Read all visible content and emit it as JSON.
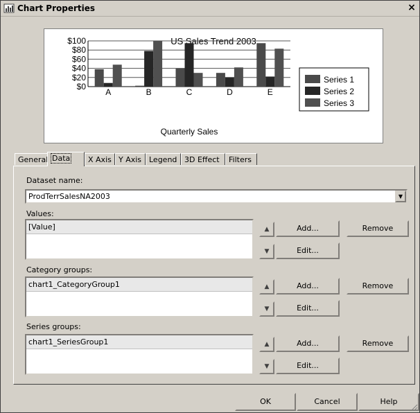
{
  "window": {
    "title": "Chart Properties",
    "close_glyph": "×",
    "app_icon": "chart-icon"
  },
  "chart_data": {
    "type": "bar",
    "title": "US Sales Trend 2003",
    "xlabel": "Quarterly Sales",
    "ylabel": "",
    "categories": [
      "A",
      "B",
      "C",
      "D",
      "E"
    ],
    "y_tick_labels": [
      "$100",
      "$80",
      "$60",
      "$40",
      "$20",
      "$0"
    ],
    "ylim": [
      0,
      100
    ],
    "grid": true,
    "legend_position": "right",
    "series": [
      {
        "name": "Series 1",
        "values": [
          38,
          2,
          40,
          30,
          95
        ],
        "color": "#4a4a4a"
      },
      {
        "name": "Series 2",
        "values": [
          8,
          78,
          95,
          20,
          22
        ],
        "color": "#262626"
      },
      {
        "name": "Series 3",
        "values": [
          48,
          100,
          30,
          42,
          83
        ],
        "color": "#505050"
      }
    ]
  },
  "tabs": [
    "General",
    "Data",
    "X Axis",
    "Y Axis",
    "Legend",
    "3D Effect",
    "Filters"
  ],
  "active_tab": "Data",
  "dataset": {
    "label": "Dataset name:",
    "value": "ProdTerrSalesNA2003"
  },
  "values_section": {
    "label": "Values:",
    "item": "[Value]"
  },
  "category_section": {
    "label": "Category groups:",
    "item": "chart1_CategoryGroup1"
  },
  "series_section": {
    "label": "Series groups:",
    "item": "chart1_SeriesGroup1"
  },
  "buttons": {
    "add": "Add...",
    "edit": "Edit...",
    "remove": "Remove",
    "ok": "OK",
    "cancel": "Cancel",
    "help": "Help"
  },
  "icons": {
    "up": "up-arrow-icon",
    "down": "down-arrow-icon",
    "dropdown": "chevron-down-icon"
  }
}
